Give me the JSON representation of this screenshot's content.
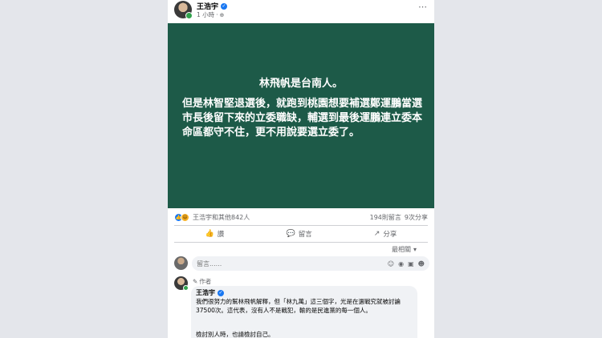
{
  "post": {
    "author": "王浩宇",
    "time": "1 小時",
    "more_icon": "⋯",
    "image_title": "林飛帆是台南人。",
    "image_body": "但是林智堅退選後，就跑到桃園想要補選鄭運鵬當選市長後留下來的立委職缺，輔選到最後運鵬連立委本命區都守不住，更不用說要選立委了。"
  },
  "reactions": {
    "summary": "王浩宇和其他842人",
    "comments": "194則留言",
    "shares": "9次分享",
    "icons": [
      "like-icon",
      "haha-icon"
    ]
  },
  "actions": {
    "like": "讚",
    "comment": "留言",
    "share": "分享"
  },
  "sort": {
    "label": "最相關"
  },
  "composer": {
    "placeholder": "留言......"
  },
  "comment": {
    "badge": "作者",
    "author": "王浩宇",
    "text": "我們很努力的幫林飛帆解釋，但「林九萬」這三個字，光是在選戰究就被討論37500次。這代表，沒有人不是戰犯，輸的是民進黨的每一個人。",
    "text2": "檢討別人時，也請檢討自己。"
  },
  "colors": {
    "image_bg": "#1d5a48",
    "accent": "#1877f2"
  }
}
